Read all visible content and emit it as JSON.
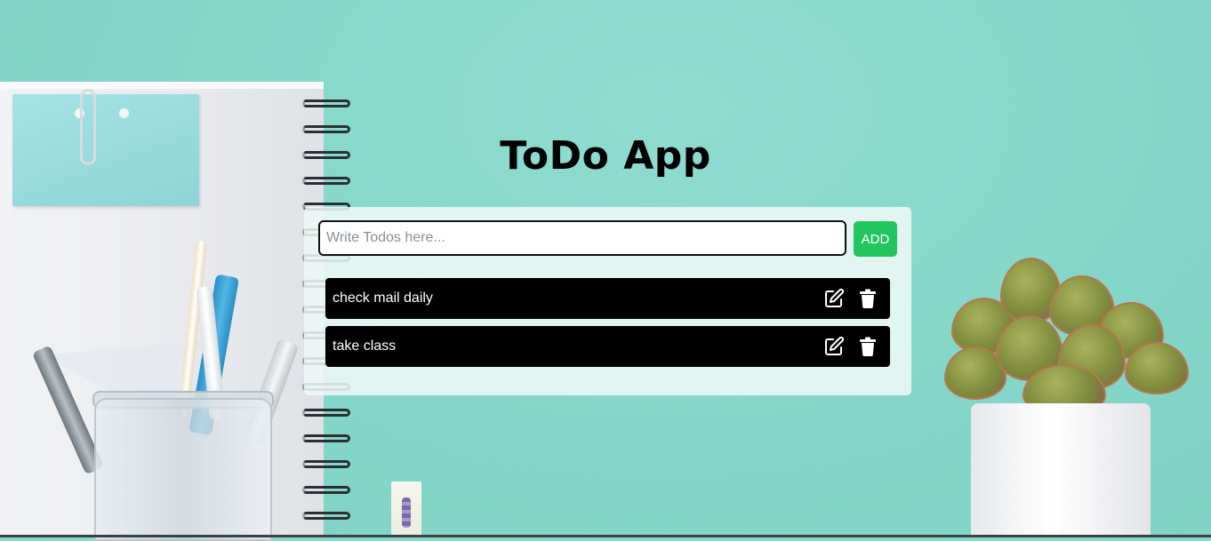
{
  "app": {
    "title": "ToDo App"
  },
  "form": {
    "input_value": "",
    "input_placeholder": "Write Todos here...",
    "add_label": "ADD"
  },
  "todos": [
    {
      "text": "check mail daily",
      "edit_icon": "edit-icon",
      "delete_icon": "trash-icon"
    },
    {
      "text": "take class",
      "edit_icon": "edit-icon",
      "delete_icon": "trash-icon"
    }
  ],
  "colors": {
    "background": "#86d9cb",
    "card": "#eef8f6",
    "add_button": "#22c55e",
    "todo_item": "#000000",
    "todo_text": "#ffffff"
  }
}
